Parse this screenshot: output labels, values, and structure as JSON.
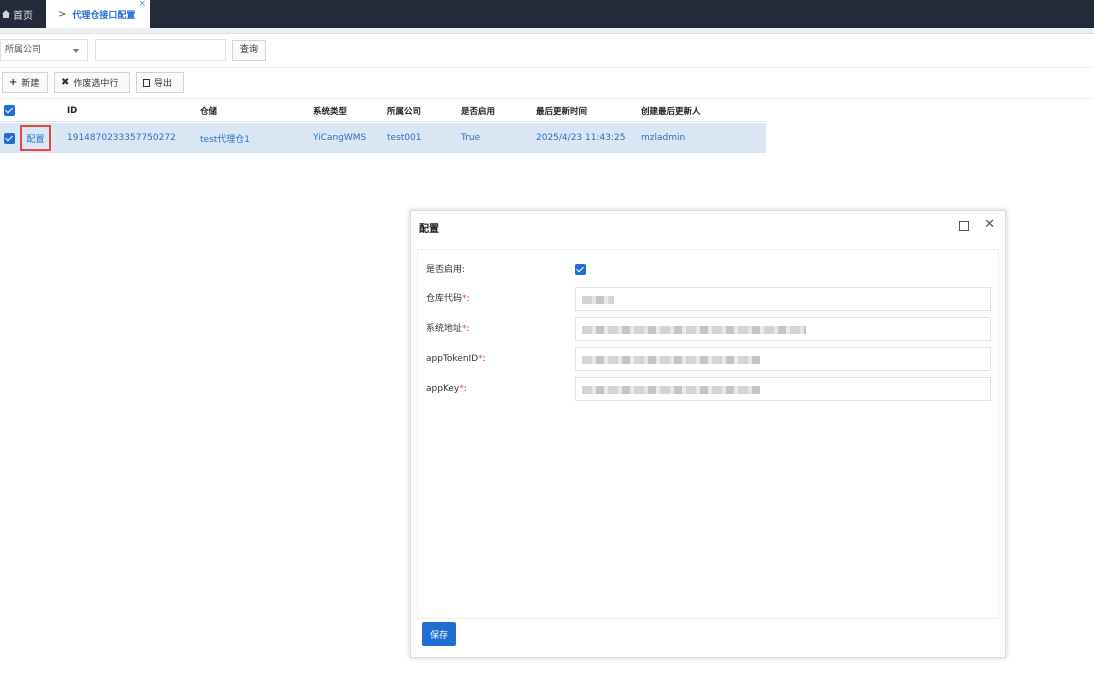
{
  "tabs": {
    "home_label": "首页",
    "active_label": "代理仓接口配置",
    "close_glyph": "×",
    "chevron_glyph": ">"
  },
  "filter": {
    "company_select_value": "所属公司",
    "search_value": "",
    "query_label": "查询"
  },
  "toolbar": {
    "new_label": "新建",
    "void_label": "作废选中行",
    "export_label": "导出"
  },
  "table": {
    "headers": [
      "ID",
      "仓储",
      "系统类型",
      "所属公司",
      "是否启用",
      "最后更新时间",
      "创建最后更新人"
    ],
    "rows": [
      {
        "action_label": "配置",
        "id": "1914870233357750272",
        "warehouse": "test代理仓1",
        "system_type": "YiCangWMS",
        "company": "test001",
        "enabled": "True",
        "updated_at": "2025/4/23 11:43:25",
        "updated_by": "mzladmin"
      }
    ]
  },
  "modal": {
    "title": "配置",
    "fields": {
      "enabled_label": "是否启用:",
      "warehouse_code_label": "仓库代码",
      "system_address_label": "系统地址",
      "app_token_label": "appTokenID",
      "app_key_label": "appKey",
      "required_mark": "*",
      "colon": ":"
    },
    "save_label": "保存"
  },
  "colors": {
    "primary": "#1e6fd1",
    "topbar": "#232b3a",
    "row_selected": "#dbe6f5",
    "highlight_red": "#e5483c"
  }
}
